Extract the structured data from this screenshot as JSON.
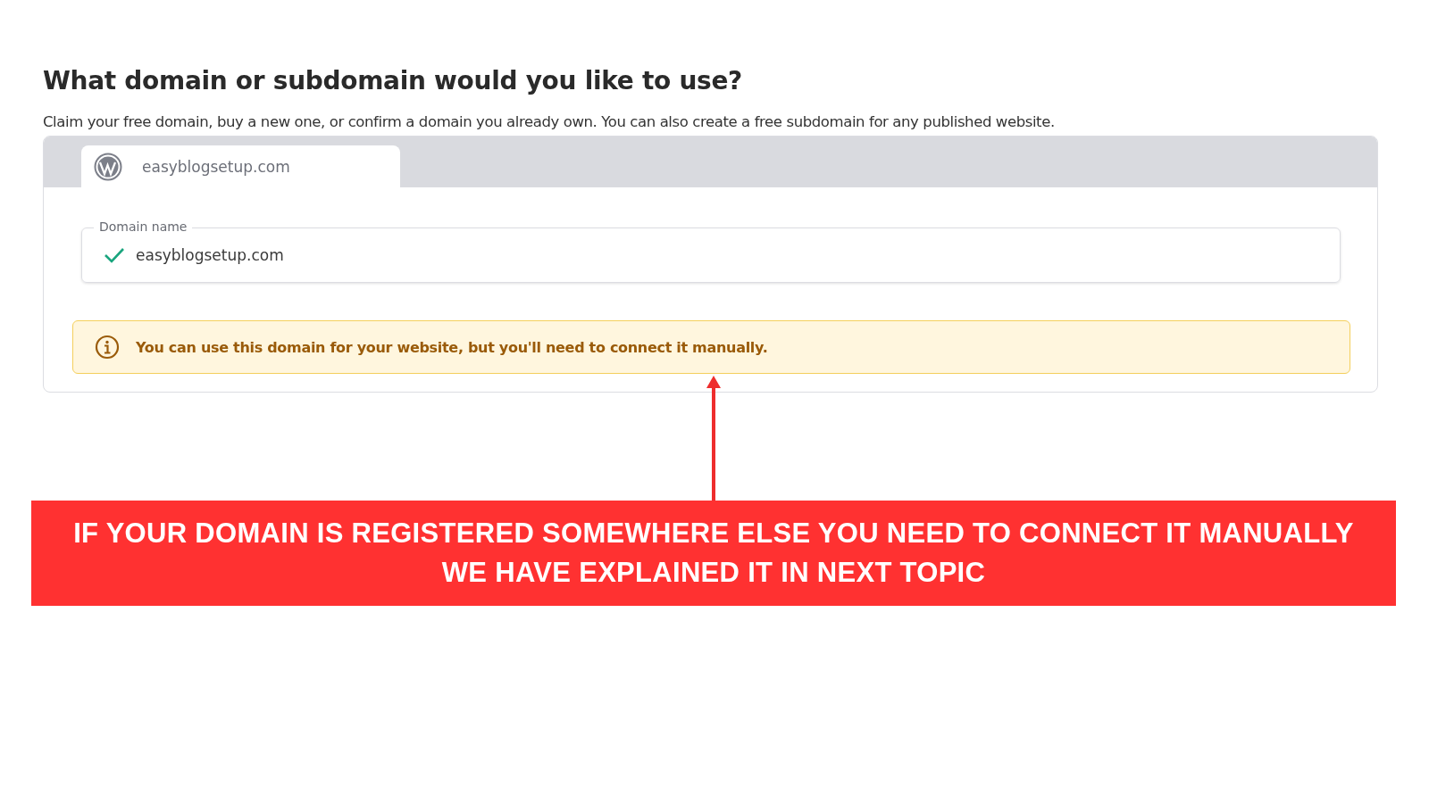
{
  "heading": "What domain or subdomain would you like to use?",
  "description": "Claim your free domain, buy a new one, or confirm a domain you already own. You can also create a free subdomain for any published website.",
  "tabs": [
    {
      "label": "easyblogsetup.com",
      "selected": true
    }
  ],
  "field": {
    "label": "Domain name",
    "value": "easyblogsetup.com",
    "valid": true
  },
  "notice": {
    "text": "You can use this domain for your website, but you'll need to connect it manually."
  },
  "annotation": {
    "lines": [
      "IF YOUR DOMAIN IS REGISTERED SOMEWHERE ELSE YOU NEED TO CONNECT IT MANUALLY",
      "WE HAVE EXPLAINED IT IN NEXT TOPIC"
    ]
  }
}
